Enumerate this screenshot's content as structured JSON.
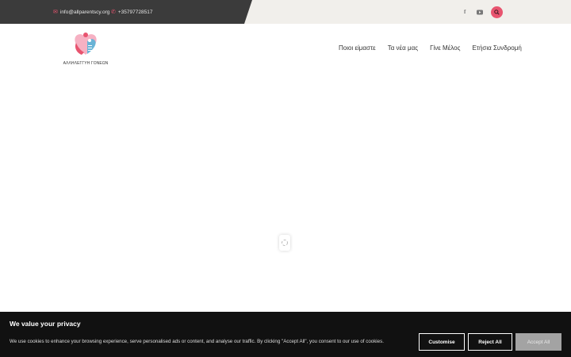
{
  "topbar": {
    "email": "info@allparentscy.org",
    "phone": "+35797728517",
    "social": [
      {
        "name": "facebook-icon",
        "glyph": "f"
      },
      {
        "name": "youtube-icon",
        "glyph": "▶"
      }
    ]
  },
  "header": {
    "logo_text": "ΑΛΛΗΛΕΓΓΥΗ ΓΟΝΕΩΝ",
    "nav": [
      "Ποιοι είμαστε",
      "Τα νέα μας",
      "Γίνε Μέλος",
      "Ετήσια Συνδρομή"
    ]
  },
  "cookie": {
    "title": "We value your privacy",
    "text": "We use cookies to enhance your browsing experience, serve personalised ads or content, and analyse our traffic. By clicking \"Accept All\", you consent to our use of cookies.",
    "customise": "Customise",
    "reject": "Reject All",
    "accept": "Accept All"
  },
  "colors": {
    "accent": "#e8546f",
    "topbar_dark": "#3b3b3b",
    "topbar_light": "#f1efeb",
    "banner": "#111111"
  }
}
